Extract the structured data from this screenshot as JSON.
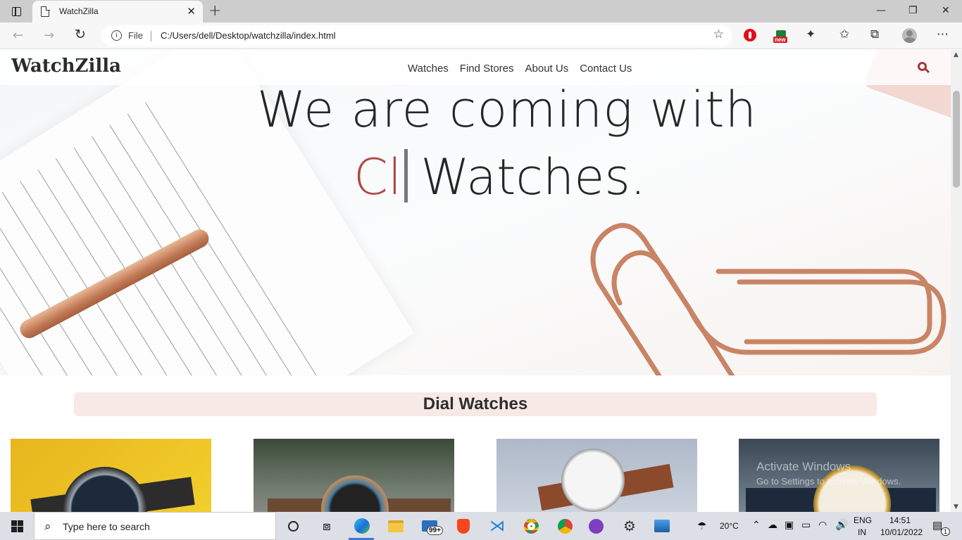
{
  "browser": {
    "tab_title": "WatchZilla",
    "tab_close": "✕",
    "new_tab": "+",
    "window_controls": {
      "minimize": "—",
      "maximize": "❐",
      "close": "✕"
    },
    "url_scheme_label": "File",
    "url": "C:/Users/dell/Desktop/watchzilla/index.html",
    "extension_badge": "new"
  },
  "site": {
    "brand": "WatchZilla",
    "nav": [
      "Watches",
      "Find Stores",
      "About Us",
      "Contact Us"
    ],
    "hero": {
      "line1": "We are coming with",
      "typed_text": "Cl",
      "line2_rest": "Watches."
    },
    "section_title": "Dial Watches"
  },
  "watermark": {
    "line1": "Activate Windows",
    "line2": "Go to Settings to activate Windows."
  },
  "taskbar": {
    "search_placeholder": "Type here to search",
    "mail_badge": "99+",
    "weather": "20°C",
    "language": "ENG",
    "region": "IN",
    "time": "14:51",
    "date": "10/01/2022",
    "notification_count": "1"
  },
  "colors": {
    "accent": "#a8373a",
    "typed": "#b04a45",
    "section_bg": "#f7e9e6"
  }
}
